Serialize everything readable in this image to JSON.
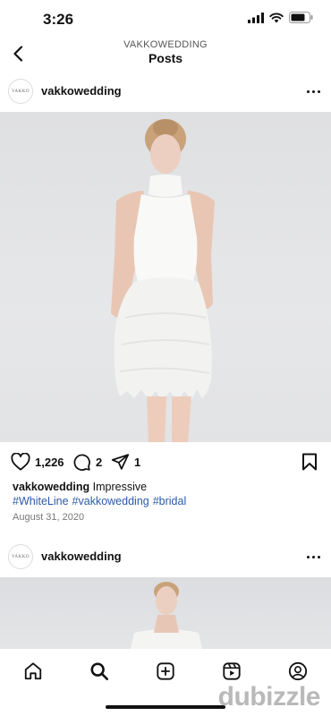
{
  "status_bar": {
    "time": "3:26"
  },
  "header": {
    "account": "VAKKOWEDDING",
    "title": "Posts"
  },
  "post": {
    "username": "vakkowedding",
    "avatar_text": "VAKKO",
    "likes": "1,226",
    "comments": "2",
    "shares": "1",
    "caption_user": "vakkowedding",
    "caption_text": " Impressive",
    "hashtags": [
      "#WhiteLine",
      "#vakkowedding",
      "#bridal"
    ],
    "date": "August 31, 2020"
  },
  "post2": {
    "username": "vakkowedding",
    "avatar_text": "VAKKO"
  },
  "watermark": "dubizzle",
  "icons": {
    "back": "chevron-left-icon",
    "more": "more-horizontal-icon",
    "like": "heart-icon",
    "comment": "comment-icon",
    "share": "send-icon",
    "save": "bookmark-icon",
    "home": "home-icon",
    "search": "search-icon",
    "create": "plus-square-icon",
    "reels": "reels-icon",
    "profile": "profile-icon"
  }
}
